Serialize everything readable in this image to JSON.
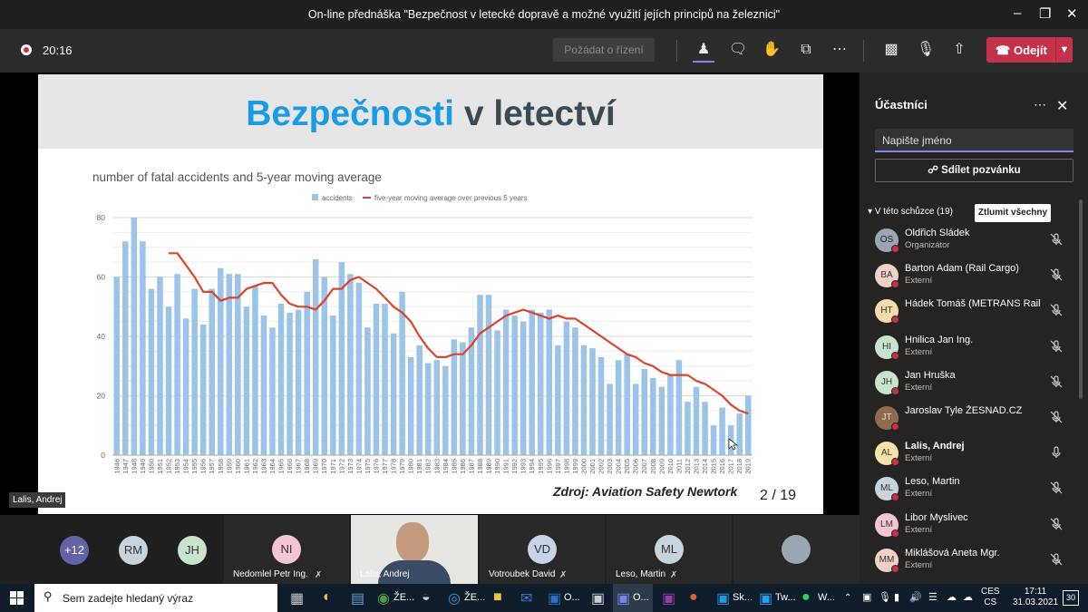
{
  "window": {
    "title": "On-line přednáška \"Bezpečnost v letecké dopravě a možné využití jejích principů na železnici\""
  },
  "toolbar": {
    "time": "20:16",
    "request_control": "Požádat o řízení",
    "leave": "Odejít"
  },
  "slide": {
    "title_a": "Bezpečnosti",
    "title_b": "v letectví",
    "source": "Zdroj: Aviation Safety Newtork",
    "page": "2 / 19",
    "speaker": "Lalis, Andrej"
  },
  "chart_data": {
    "type": "bar",
    "title": "number of fatal accidents and 5-year moving average",
    "series_names": [
      "accidents",
      "five-year moving average over previous 5 years"
    ],
    "ylim": [
      0,
      80
    ],
    "yticks": [
      "0",
      "20",
      "40",
      "60",
      "80"
    ],
    "categories": [
      "1946",
      "1947",
      "1948",
      "1949",
      "1950",
      "1951",
      "1952",
      "1953",
      "1954",
      "1955",
      "1956",
      "1957",
      "1958",
      "1959",
      "1960",
      "1961",
      "1962",
      "1963",
      "1964",
      "1965",
      "1966",
      "1967",
      "1968",
      "1969",
      "1970",
      "1971",
      "1972",
      "1973",
      "1974",
      "1975",
      "1976",
      "1977",
      "1978",
      "1979",
      "1980",
      "1981",
      "1982",
      "1983",
      "1984",
      "1985",
      "1986",
      "1987",
      "1988",
      "1989",
      "1990",
      "1991",
      "1992",
      "1993",
      "1994",
      "1995",
      "1996",
      "1997",
      "1998",
      "1999",
      "2000",
      "2001",
      "2002",
      "2003",
      "2004",
      "2005",
      "2006",
      "2007",
      "2008",
      "2009",
      "2010",
      "2011",
      "2012",
      "2013",
      "2014",
      "2015",
      "2016",
      "2017",
      "2018",
      "2019"
    ],
    "values": [
      60,
      72,
      80,
      72,
      56,
      60,
      50,
      61,
      46,
      56,
      44,
      56,
      63,
      61,
      61,
      50,
      57,
      47,
      43,
      51,
      48,
      49,
      55,
      66,
      60,
      47,
      65,
      61,
      58,
      43,
      51,
      51,
      41,
      55,
      33,
      37,
      31,
      32,
      30,
      39,
      38,
      43,
      54,
      54,
      42,
      49,
      47,
      45,
      49,
      48,
      49,
      37,
      45,
      43,
      37,
      36,
      33,
      24,
      32,
      34,
      24,
      29,
      26,
      23,
      27,
      32,
      18,
      23,
      18,
      10,
      16,
      10,
      14,
      20
    ],
    "moving_average": [
      null,
      null,
      null,
      null,
      null,
      null,
      68,
      68,
      64,
      60,
      55,
      55,
      52,
      53,
      53,
      56,
      57,
      58,
      58,
      54,
      51,
      50,
      50,
      49,
      52,
      56,
      56,
      59,
      60,
      58,
      56,
      53,
      50,
      48,
      45,
      40,
      36,
      33,
      33,
      34,
      34,
      37,
      41,
      43,
      45,
      47,
      48,
      49,
      48,
      47,
      46,
      47,
      46,
      46,
      44,
      42,
      40,
      38,
      36,
      34,
      33,
      31,
      30,
      28,
      27,
      27,
      27,
      25,
      24,
      22,
      20,
      17,
      15,
      14
    ]
  },
  "strip": [
    {
      "initials": "+12",
      "color": "#6264a7",
      "label": ""
    },
    {
      "initials": "RM",
      "color": "#c7d3dd",
      "label": ""
    },
    {
      "initials": "JH",
      "color": "#c8e4cc",
      "label": ""
    },
    {
      "initials": "NI",
      "color": "#f4c6d4",
      "label": "Nedomlel Petr Ing."
    },
    {
      "initials": "",
      "color": "",
      "label": "Lalis, Andrej"
    },
    {
      "initials": "VD",
      "color": "#c7d3e8",
      "label": "Votroubek David"
    },
    {
      "initials": "ML",
      "color": "#c7d3dd",
      "label": "Leso, Martin"
    },
    {
      "initials": "",
      "color": "#9aa6b2",
      "label": ""
    }
  ],
  "panel": {
    "title": "Účastníci",
    "search_placeholder": "Napište jméno",
    "invite": "Sdílet pozvánku",
    "section": "V této schůzce (19)",
    "mute_all": "Ztlumit všechny",
    "participants": [
      {
        "initials": "OS",
        "color": "#9aa6b2",
        "name": "Oldřich Sládek",
        "role": "Organizátor",
        "bold": false
      },
      {
        "initials": "BA",
        "color": "#f2d0c8",
        "name": "Barton Adam (Rail Cargo)",
        "role": "Externí",
        "bold": false
      },
      {
        "initials": "HT",
        "color": "#f6dcaa",
        "name": "Hádek Tomáš (METRANS Rail)",
        "role": "",
        "bold": false
      },
      {
        "initials": "HI",
        "color": "#c8e4cc",
        "name": "Hnilica Jan Ing.",
        "role": "Externí",
        "bold": false
      },
      {
        "initials": "JH",
        "color": "#c8e4cc",
        "name": "Jan Hruška",
        "role": "Externí",
        "bold": false
      },
      {
        "initials": "JT",
        "color": "#8f6a4f",
        "name": "Jaroslav Tyle ŽESNAD.CZ",
        "role": "",
        "bold": false
      },
      {
        "initials": "AL",
        "color": "#f6e3a8",
        "name": "Lalis, Andrej",
        "role": "Externí",
        "bold": true
      },
      {
        "initials": "ML",
        "color": "#c7d3dd",
        "name": "Leso, Martin",
        "role": "Externí",
        "bold": false
      },
      {
        "initials": "LM",
        "color": "#f4c6d4",
        "name": "Libor Myslivec",
        "role": "Externí",
        "bold": false
      },
      {
        "initials": "MM",
        "color": "#f2d0c8",
        "name": "Miklášová Aneta Mgr.",
        "role": "Externí",
        "bold": false
      }
    ]
  },
  "taskbar": {
    "search_placeholder": "Sem zadejte hledaný výraz",
    "lang1": "CES",
    "lang2": "CS",
    "time": "17:11",
    "date": "31.03.2021",
    "notifications": "30",
    "apps": [
      "ŽE...",
      "ŽE...",
      "O...",
      "O...",
      "Sk...",
      "Tw...",
      "W..."
    ]
  }
}
